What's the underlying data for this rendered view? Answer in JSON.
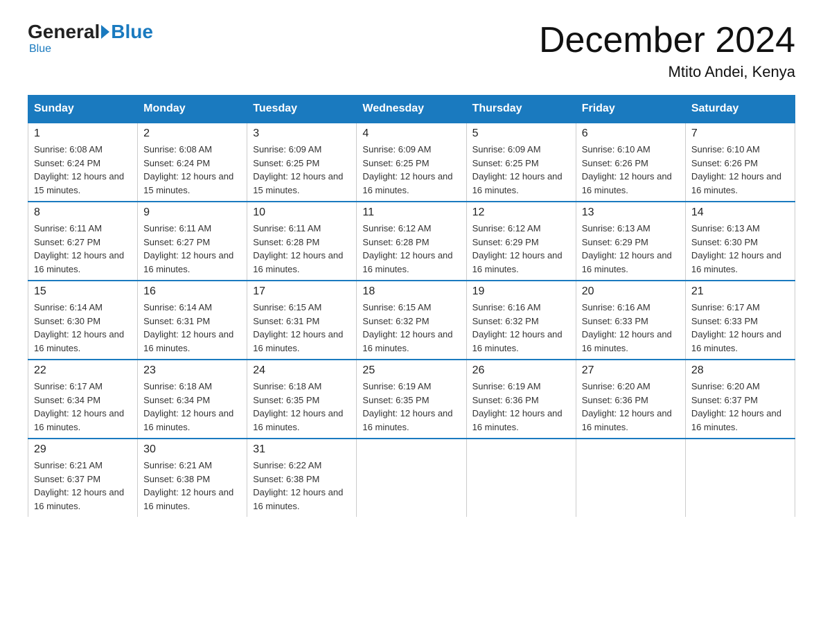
{
  "logo": {
    "general": "General",
    "blue": "Blue"
  },
  "title": "December 2024",
  "location": "Mtito Andei, Kenya",
  "days_of_week": [
    "Sunday",
    "Monday",
    "Tuesday",
    "Wednesday",
    "Thursday",
    "Friday",
    "Saturday"
  ],
  "weeks": [
    [
      {
        "day": "1",
        "sunrise": "6:08 AM",
        "sunset": "6:24 PM",
        "daylight": "12 hours and 15 minutes."
      },
      {
        "day": "2",
        "sunrise": "6:08 AM",
        "sunset": "6:24 PM",
        "daylight": "12 hours and 15 minutes."
      },
      {
        "day": "3",
        "sunrise": "6:09 AM",
        "sunset": "6:25 PM",
        "daylight": "12 hours and 15 minutes."
      },
      {
        "day": "4",
        "sunrise": "6:09 AM",
        "sunset": "6:25 PM",
        "daylight": "12 hours and 16 minutes."
      },
      {
        "day": "5",
        "sunrise": "6:09 AM",
        "sunset": "6:25 PM",
        "daylight": "12 hours and 16 minutes."
      },
      {
        "day": "6",
        "sunrise": "6:10 AM",
        "sunset": "6:26 PM",
        "daylight": "12 hours and 16 minutes."
      },
      {
        "day": "7",
        "sunrise": "6:10 AM",
        "sunset": "6:26 PM",
        "daylight": "12 hours and 16 minutes."
      }
    ],
    [
      {
        "day": "8",
        "sunrise": "6:11 AM",
        "sunset": "6:27 PM",
        "daylight": "12 hours and 16 minutes."
      },
      {
        "day": "9",
        "sunrise": "6:11 AM",
        "sunset": "6:27 PM",
        "daylight": "12 hours and 16 minutes."
      },
      {
        "day": "10",
        "sunrise": "6:11 AM",
        "sunset": "6:28 PM",
        "daylight": "12 hours and 16 minutes."
      },
      {
        "day": "11",
        "sunrise": "6:12 AM",
        "sunset": "6:28 PM",
        "daylight": "12 hours and 16 minutes."
      },
      {
        "day": "12",
        "sunrise": "6:12 AM",
        "sunset": "6:29 PM",
        "daylight": "12 hours and 16 minutes."
      },
      {
        "day": "13",
        "sunrise": "6:13 AM",
        "sunset": "6:29 PM",
        "daylight": "12 hours and 16 minutes."
      },
      {
        "day": "14",
        "sunrise": "6:13 AM",
        "sunset": "6:30 PM",
        "daylight": "12 hours and 16 minutes."
      }
    ],
    [
      {
        "day": "15",
        "sunrise": "6:14 AM",
        "sunset": "6:30 PM",
        "daylight": "12 hours and 16 minutes."
      },
      {
        "day": "16",
        "sunrise": "6:14 AM",
        "sunset": "6:31 PM",
        "daylight": "12 hours and 16 minutes."
      },
      {
        "day": "17",
        "sunrise": "6:15 AM",
        "sunset": "6:31 PM",
        "daylight": "12 hours and 16 minutes."
      },
      {
        "day": "18",
        "sunrise": "6:15 AM",
        "sunset": "6:32 PM",
        "daylight": "12 hours and 16 minutes."
      },
      {
        "day": "19",
        "sunrise": "6:16 AM",
        "sunset": "6:32 PM",
        "daylight": "12 hours and 16 minutes."
      },
      {
        "day": "20",
        "sunrise": "6:16 AM",
        "sunset": "6:33 PM",
        "daylight": "12 hours and 16 minutes."
      },
      {
        "day": "21",
        "sunrise": "6:17 AM",
        "sunset": "6:33 PM",
        "daylight": "12 hours and 16 minutes."
      }
    ],
    [
      {
        "day": "22",
        "sunrise": "6:17 AM",
        "sunset": "6:34 PM",
        "daylight": "12 hours and 16 minutes."
      },
      {
        "day": "23",
        "sunrise": "6:18 AM",
        "sunset": "6:34 PM",
        "daylight": "12 hours and 16 minutes."
      },
      {
        "day": "24",
        "sunrise": "6:18 AM",
        "sunset": "6:35 PM",
        "daylight": "12 hours and 16 minutes."
      },
      {
        "day": "25",
        "sunrise": "6:19 AM",
        "sunset": "6:35 PM",
        "daylight": "12 hours and 16 minutes."
      },
      {
        "day": "26",
        "sunrise": "6:19 AM",
        "sunset": "6:36 PM",
        "daylight": "12 hours and 16 minutes."
      },
      {
        "day": "27",
        "sunrise": "6:20 AM",
        "sunset": "6:36 PM",
        "daylight": "12 hours and 16 minutes."
      },
      {
        "day": "28",
        "sunrise": "6:20 AM",
        "sunset": "6:37 PM",
        "daylight": "12 hours and 16 minutes."
      }
    ],
    [
      {
        "day": "29",
        "sunrise": "6:21 AM",
        "sunset": "6:37 PM",
        "daylight": "12 hours and 16 minutes."
      },
      {
        "day": "30",
        "sunrise": "6:21 AM",
        "sunset": "6:38 PM",
        "daylight": "12 hours and 16 minutes."
      },
      {
        "day": "31",
        "sunrise": "6:22 AM",
        "sunset": "6:38 PM",
        "daylight": "12 hours and 16 minutes."
      },
      null,
      null,
      null,
      null
    ]
  ],
  "labels": {
    "sunrise": "Sunrise:",
    "sunset": "Sunset:",
    "daylight": "Daylight:"
  }
}
